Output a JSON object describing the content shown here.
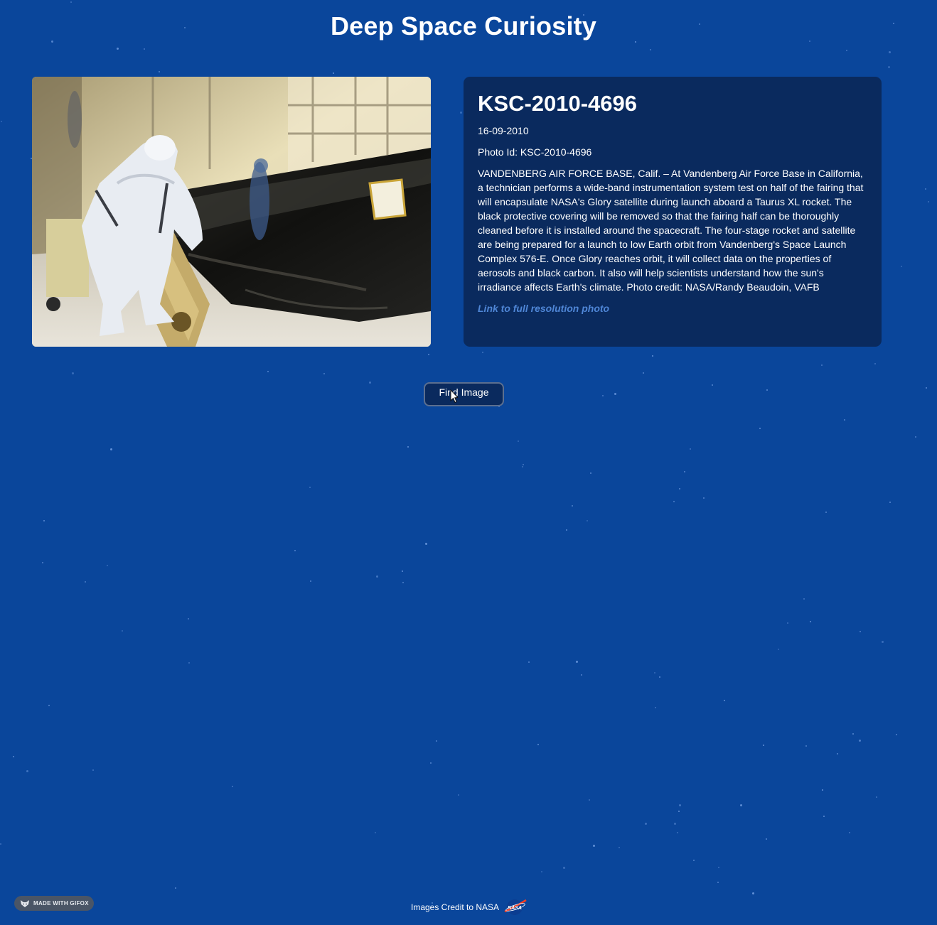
{
  "header": {
    "title": "Deep Space Curiosity"
  },
  "photo": {
    "alt": "Technician inspecting a fairing half covered in black protective plastic"
  },
  "details": {
    "title": "KSC-2010-4696",
    "date": "16-09-2010",
    "photo_id": "Photo Id: KSC-2010-4696",
    "description": "VANDENBERG AIR FORCE BASE, Calif. – At Vandenberg Air Force Base in California, a technician performs a wide-band instrumentation system test on half of the fairing that will encapsulate NASA's Glory satellite during launch aboard a Taurus XL rocket. The black protective covering will be removed so that the fairing half can be thoroughly cleaned before it is installed around the spacecraft. The four-stage rocket and satellite are being prepared for a launch to low Earth orbit from Vandenberg's Space Launch Complex 576-E. Once Glory reaches orbit, it will collect data on the properties of aerosols and black carbon. It also will help scientists understand how the sun's irradiance affects Earth's climate. Photo credit: NASA/Randy Beaudoin, VAFB",
    "link_label": "Link to full resolution photo"
  },
  "actions": {
    "find_label": "Find Image"
  },
  "badge": {
    "label": "MADE WITH GIFOX"
  },
  "footer": {
    "credit": "Images Credit to NASA",
    "logo_text": "NASA"
  },
  "colors": {
    "background": "#0a469b",
    "card": "#0a2a5e",
    "link": "#4f86d6"
  }
}
